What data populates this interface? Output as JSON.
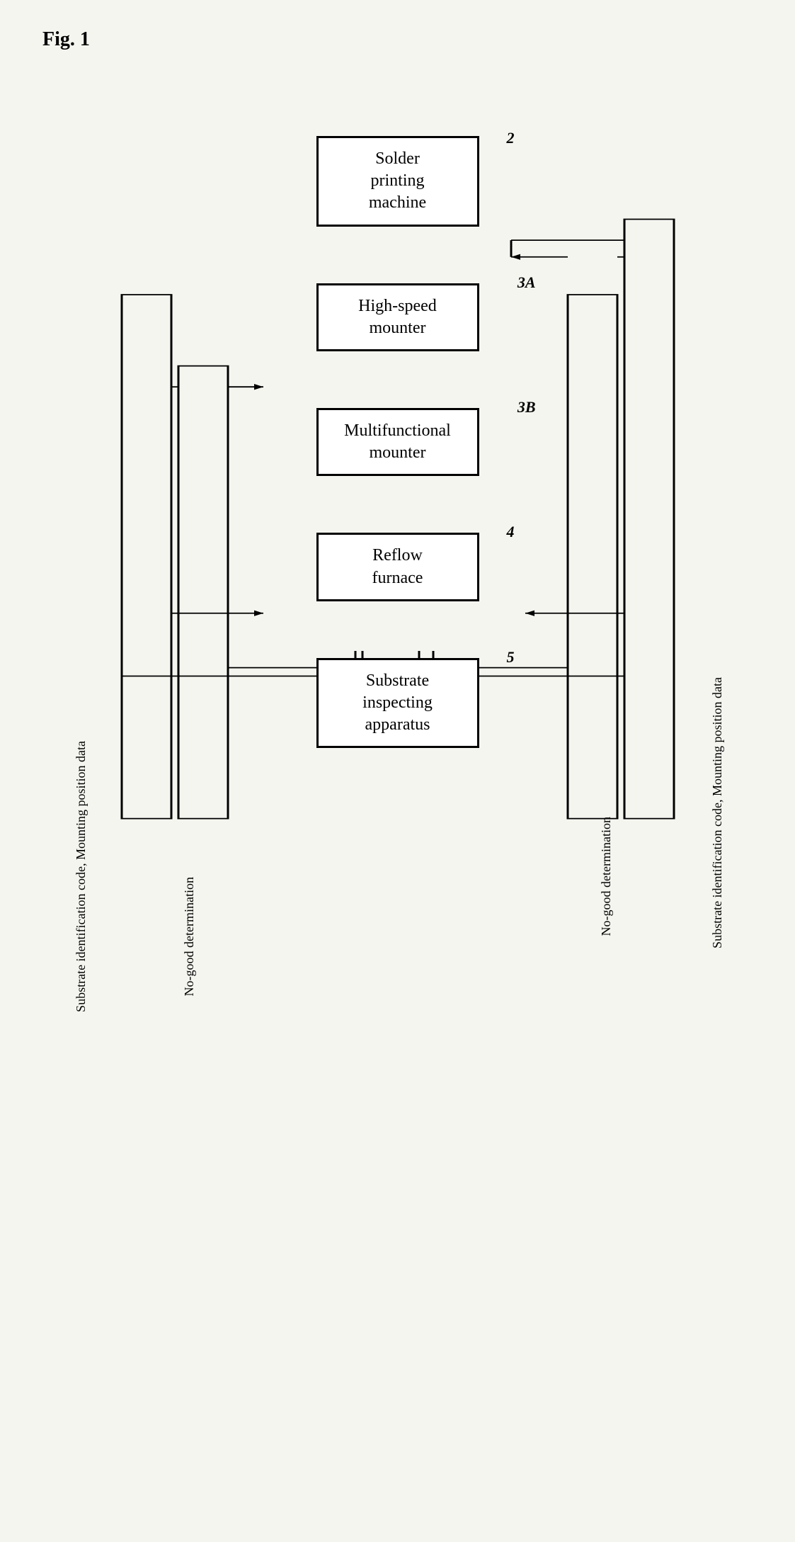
{
  "figure": {
    "label": "Fig. 1"
  },
  "nodes": {
    "solder_printing": {
      "label": "Solder\nprinting\nmachine",
      "ref": "2"
    },
    "high_speed": {
      "label": "High-speed\nmounter",
      "ref": "3A"
    },
    "multifunctional": {
      "label": "Multifunctional\nmounter",
      "ref": "3B"
    },
    "reflow": {
      "label": "Reflow\nfurnace",
      "ref": "4"
    },
    "substrate_inspecting": {
      "label": "Substrate\ninspecting\napparatus",
      "ref": "5"
    }
  },
  "labels": {
    "left_outer": "Substrate identification code, Mounting\nposition data",
    "left_inner": "No-good determination",
    "right_inner": "No-good determination",
    "right_outer": "Substrate identification code, Mounting\nposition data"
  }
}
